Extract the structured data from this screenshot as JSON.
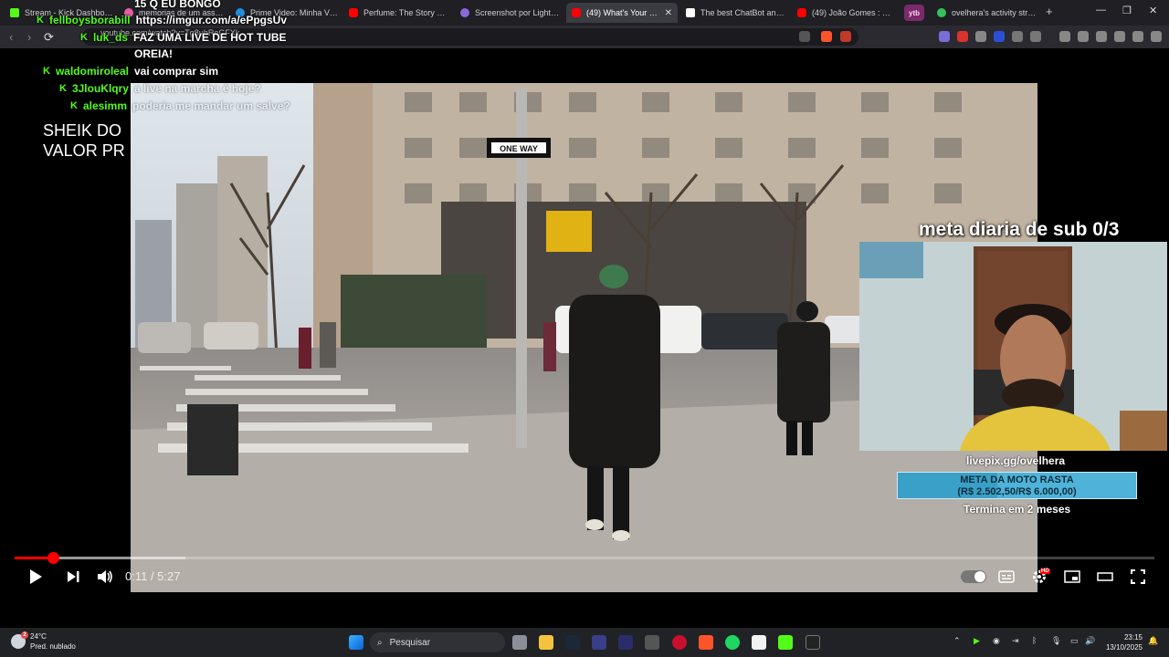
{
  "browser": {
    "tabs": [
      {
        "label": "Stream - Kick Dashboard",
        "color": "#53fc18",
        "active": false
      },
      {
        "label": "memorias de um assassino",
        "color": "#e85ca8",
        "active": false
      },
      {
        "label": "Prime Video: Minha Vida",
        "color": "#1f8fe0",
        "active": false
      },
      {
        "label": "Perfume: The Story of a M",
        "color": "#ff0000",
        "active": false
      },
      {
        "label": "Screenshot por Lightshot",
        "color": "#8a6ad8",
        "active": false
      },
      {
        "label": "(49) What's Your Fav",
        "color": "#ff0000",
        "active": true
      },
      {
        "label": "The best ChatBot and Wi",
        "color": "#ffffff",
        "active": false
      },
      {
        "label": "(49) João Gomes : Tiny D",
        "color": "#ff0000",
        "active": false
      },
      {
        "label": "ovelhera's activity stream",
        "color": "#35c25c",
        "active": false
      }
    ],
    "pinned_tab": "ytb",
    "url": "youtube.com/watch?v=Tg8ubReGFXk"
  },
  "chat": [
    {
      "user": "",
      "message": "15 Q EU BONGO",
      "faded": false
    },
    {
      "user": "fellboysborabill",
      "message": "https://imgur.com/a/ePpgsUv",
      "faded": false
    },
    {
      "user": "luk_ds",
      "message": "FAZ UMA LIVE DE HOT TUBE",
      "faded": false
    },
    {
      "user": "",
      "message": "OREIA!",
      "faded": false
    },
    {
      "user": "waldomiroleal",
      "message": "vai comprar sim",
      "faded": false
    },
    {
      "user": "3JlouKlqry",
      "message": "a live na marcha é hoje?",
      "faded": true
    },
    {
      "user": "alesimm",
      "message": "poderia me mandar um salve?",
      "faded": true
    }
  ],
  "overlay_text": {
    "line1": "SHEIK DO",
    "line2": "VALOR PR"
  },
  "stream_overlay": {
    "sub_goal": "meta diaria de sub 0/3",
    "livepix": "livepix.gg/ovelhera",
    "goal_title": "META DA MOTO RASTA",
    "goal_amount": "(R$ 2.502,50/R$ 6.000,00)",
    "goal_progress": 0.417,
    "goal_ends": "Termina em 2 meses"
  },
  "video": {
    "street_sign": "ONE WAY",
    "time": "0:11 / 5:27",
    "played_fraction": 0.034,
    "buffered_fraction": 0.15
  },
  "taskbar": {
    "temperature": "24°C",
    "weather": "Pred. nublado",
    "weather_badge": "2",
    "search_placeholder": "Pesquisar",
    "time": "23:15",
    "date": "13/10/2025"
  }
}
